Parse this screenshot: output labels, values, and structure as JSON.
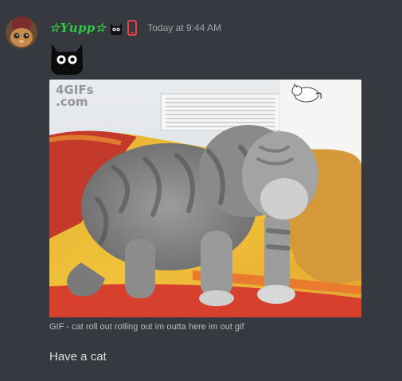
{
  "message": {
    "author": {
      "name": "☆Ƴupp☆",
      "name_color": "#2ecc40",
      "badges": [
        "black-cat-emoji",
        "mobile-phone-icon"
      ]
    },
    "timestamp": "Today at 9:44 AM",
    "big_emoji": "black-cat-emoji",
    "gif": {
      "watermark": "4GIFs\n.com",
      "caption": "GIF - cat roll out rolling out im outta here im out gif"
    },
    "text": "Have a cat"
  },
  "colors": {
    "background": "#36393f",
    "timestamp": "#a3a6aa",
    "caption": "#b9bbbe",
    "text": "#dcddde",
    "phone_icon": "#ed4245"
  }
}
